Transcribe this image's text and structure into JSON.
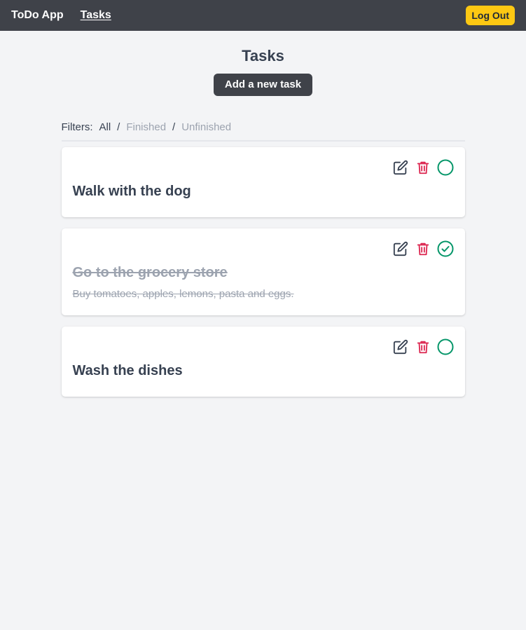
{
  "navbar": {
    "brand": "ToDo App",
    "tasks_link": "Tasks",
    "logout_label": "Log Out",
    "logout_color": "#fcc813"
  },
  "page": {
    "title": "Tasks",
    "add_button": "Add a new task"
  },
  "filters": {
    "label": "Filters:",
    "options": [
      "All",
      "Finished",
      "Unfinished"
    ],
    "separator": "/",
    "active": "All"
  },
  "tasks": [
    {
      "title": "Walk with the dog",
      "description": "",
      "done": false
    },
    {
      "title": "Go to the grocery store",
      "description": "Buy tomatoes, apples, lemons, pasta and eggs.",
      "done": true
    },
    {
      "title": "Wash the dishes",
      "description": "",
      "done": false
    }
  ],
  "icons": {
    "edit": "edit-icon",
    "delete": "trash-icon",
    "toggle_open": "circle-icon",
    "toggle_done": "check-circle-icon"
  },
  "colors": {
    "navbar": "#3f4249",
    "background": "#f3f4f6",
    "delete": "#dc2650",
    "complete": "#059669"
  }
}
